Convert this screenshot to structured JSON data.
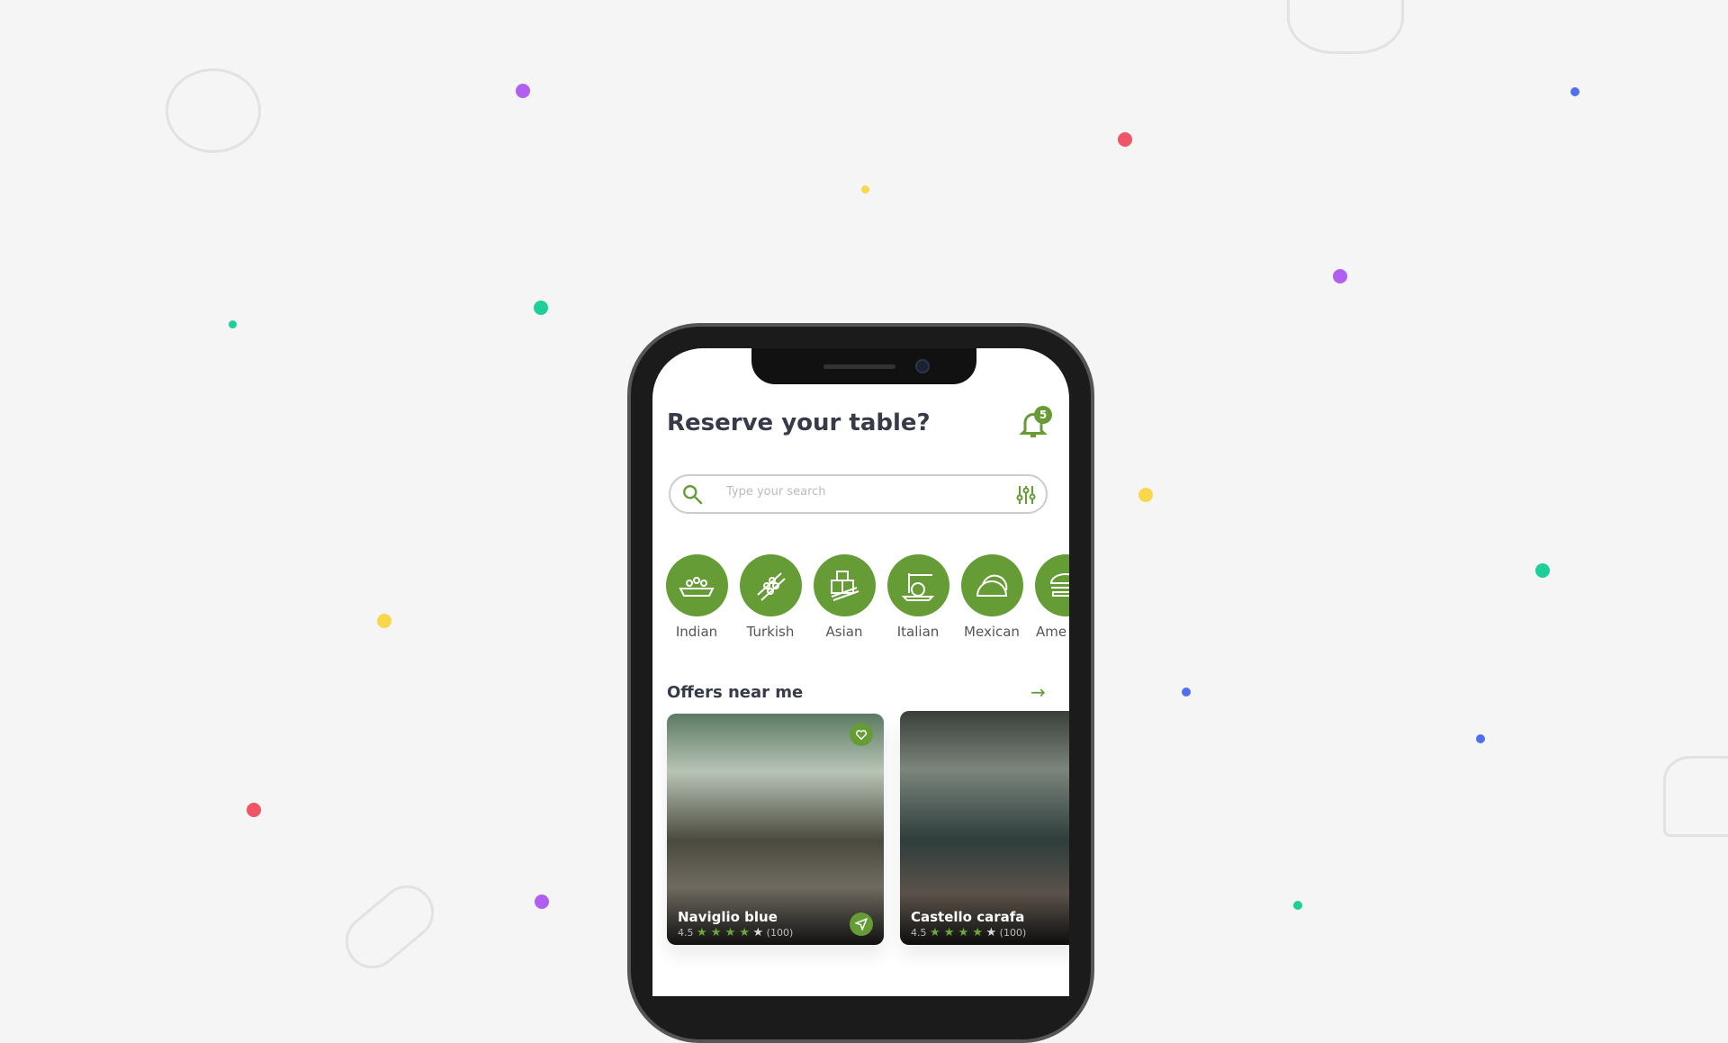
{
  "header": {
    "title": "Reserve your table?",
    "notification_count": "5"
  },
  "search": {
    "placeholder": "Type your search"
  },
  "categories": [
    {
      "label": "Indian",
      "icon": "biryani-icon"
    },
    {
      "label": "Turkish",
      "icon": "kebab-icon"
    },
    {
      "label": "Asian",
      "icon": "sushi-icon"
    },
    {
      "label": "Italian",
      "icon": "spaghetti-icon"
    },
    {
      "label": "Mexican",
      "icon": "taco-icon"
    },
    {
      "label": "Ame",
      "icon": "burger-icon"
    }
  ],
  "offers": {
    "title": "Offers near me",
    "cards": [
      {
        "name": "Naviglio blue",
        "rating": "4.5",
        "reviews": "(100)",
        "stars": 4
      },
      {
        "name": "Castello carafa",
        "rating": "4.5",
        "reviews": "(100)",
        "stars": 4
      }
    ]
  },
  "colors": {
    "accent": "#669c35",
    "background": "#f5f5f5",
    "title": "#373a48"
  }
}
